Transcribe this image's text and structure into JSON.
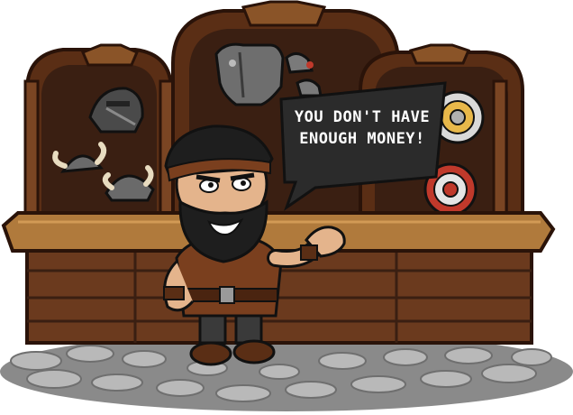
{
  "scene": {
    "type": "armor shop",
    "shopkeeper_dialog": {
      "line1": "YOU DON'T HAVE",
      "line2": "ENOUGH MONEY!"
    },
    "items_on_display": [
      "helmet-icon",
      "viking-helmet-icon",
      "horned-helmet-icon",
      "breastplate-icon",
      "pauldron-icon",
      "round-shield-icon",
      "red-shield-icon"
    ],
    "colors": {
      "wood_dark": "#3a1f12",
      "wood_mid": "#6b3a1e",
      "counter_top": "#b07a3c",
      "bubble": "#2b2b2b",
      "stone": "#9b9b9b"
    }
  }
}
